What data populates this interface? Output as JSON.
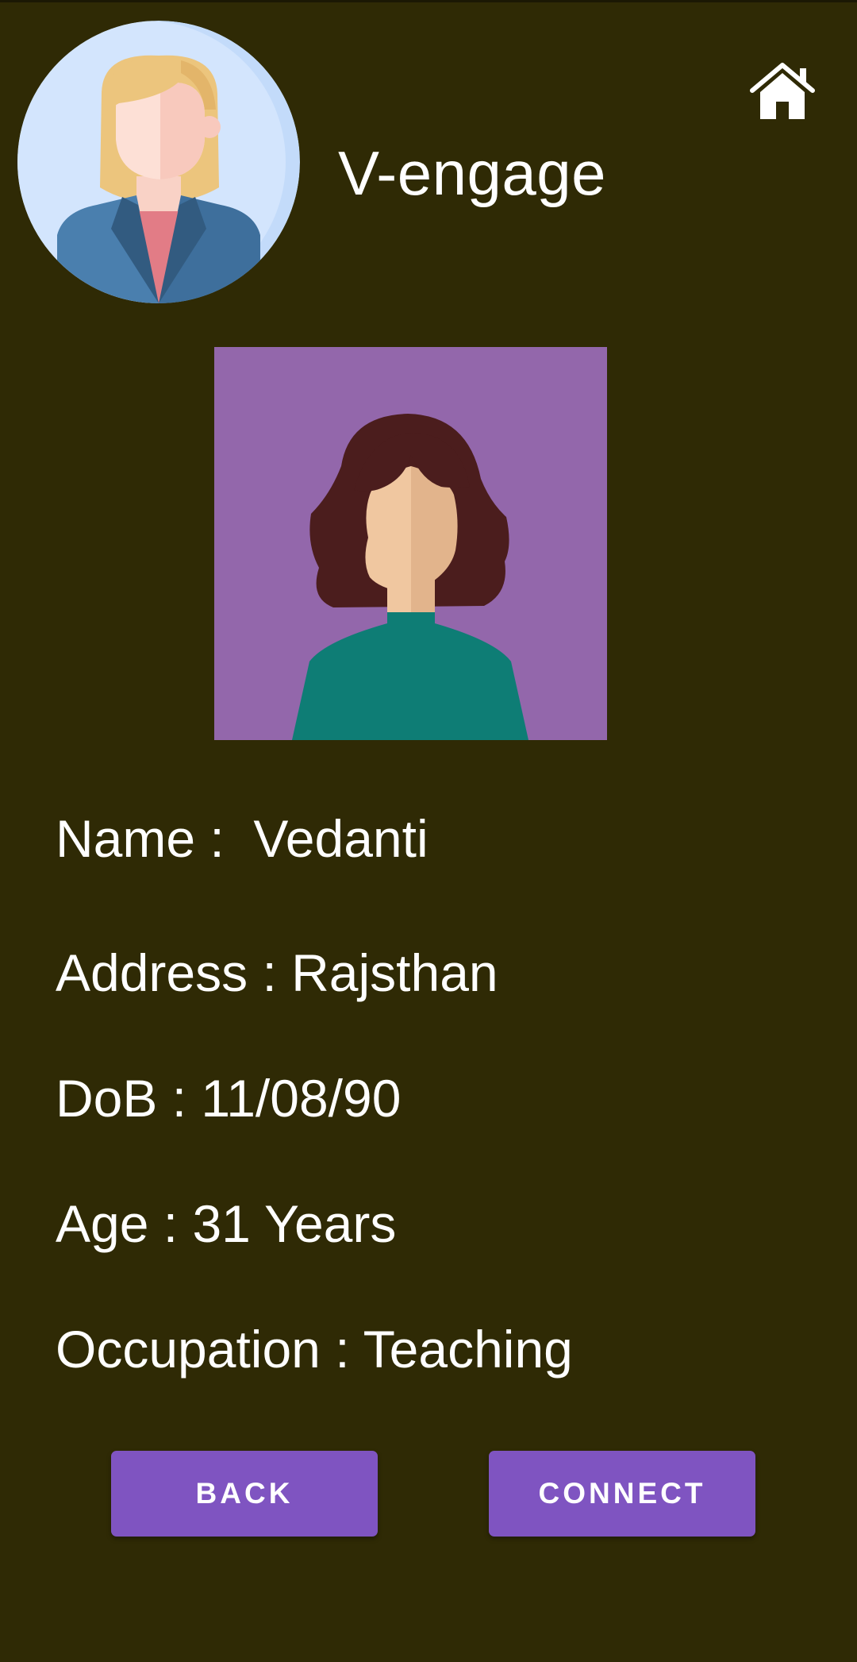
{
  "header": {
    "app_title": "V-engage",
    "avatar_icon": "businesswoman-avatar-icon",
    "home_icon": "home-icon"
  },
  "profile": {
    "photo_icon": "woman-avatar-icon",
    "name_line": "Name :  Vedanti",
    "address_line": "Address : Rajsthan",
    "dob_line": "DoB : 11/08/90",
    "age_line": "Age : 31 Years",
    "occupation_line": "Occupation : Teaching"
  },
  "actions": {
    "back_label": "BACK",
    "connect_label": "CONNECT"
  },
  "colors": {
    "background": "#2f2a05",
    "button": "#7f54c1",
    "photo_background": "#9367ab",
    "text": "#ffffff"
  }
}
